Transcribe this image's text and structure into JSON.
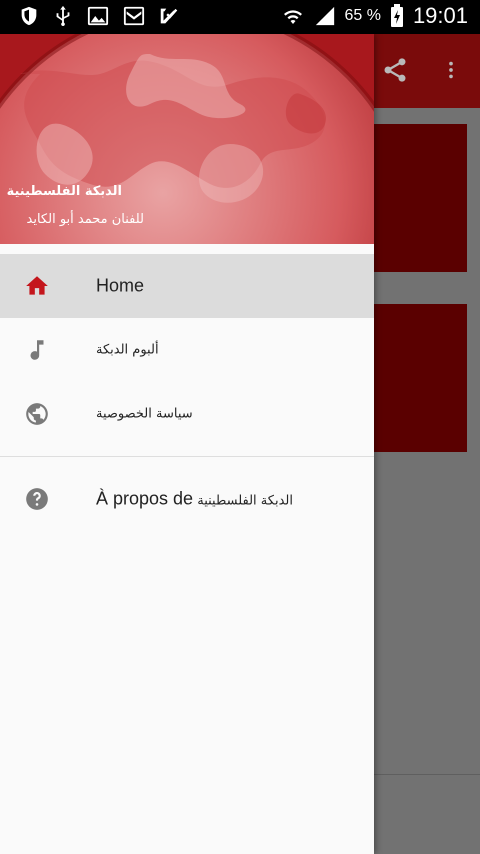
{
  "status_bar": {
    "battery_percent": "65 %",
    "time": "19:01",
    "icons": [
      "shield-icon",
      "usb-icon",
      "image-icon",
      "mail-icon",
      "check-badge-icon",
      "wifi-icon",
      "signal-icon",
      "battery-charging-icon"
    ]
  },
  "app_bar": {
    "actions": [
      "share-icon",
      "more-vert-icon"
    ],
    "color": "#7a0b0b"
  },
  "drawer": {
    "header": {
      "title": "الدبكة الفلسطينية",
      "subtitle": "للفنان محمد أبو الكايد",
      "image": "red-tinted-earth-globe"
    },
    "items": [
      {
        "label": "Home",
        "icon": "home-icon",
        "active": true
      },
      {
        "label": "ألبوم الدبكة",
        "icon": "music-note-icon",
        "active": false
      },
      {
        "label": "سياسة الخصوصية",
        "icon": "globe-icon",
        "active": false
      }
    ],
    "about": {
      "label_prefix": "À propos de",
      "label_app": "الدبكة الفلسطينية",
      "icon": "help-icon"
    },
    "accent": "#c4161c"
  }
}
